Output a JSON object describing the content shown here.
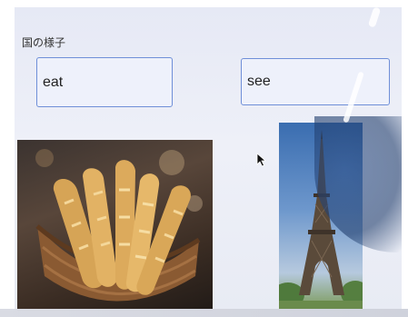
{
  "section": {
    "title": "国の様子"
  },
  "answers": {
    "left": "eat",
    "right": "see"
  },
  "images": {
    "left_icon": "bread-basket-icon",
    "right_icon": "eiffel-tower-icon"
  },
  "cursor_icon": "mouse-pointer-icon"
}
